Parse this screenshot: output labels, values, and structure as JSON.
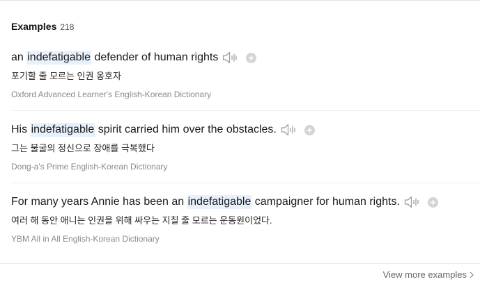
{
  "header": {
    "title": "Examples",
    "count": "218"
  },
  "examples": [
    {
      "before": "an ",
      "keyword": "indefatigable",
      "after": " defender of human rights",
      "translation": "포기할 줄 모르는 인권 옹호자",
      "source": "Oxford Advanced Learner's English-Korean Dictionary"
    },
    {
      "before": "His ",
      "keyword": "indefatigable",
      "after": " spirit carried him over the obstacles.",
      "translation": "그는 불굴의 정신으로 장애를 극복했다",
      "source": "Dong-a's Prime English-Korean Dictionary"
    },
    {
      "before": "For many years Annie has been an ",
      "keyword": "indefatigable",
      "after": " campaigner for human rights.",
      "translation": "여러 해 동안 애니는 인권을 위해 싸우는 지칠 줄 모르는 운동원이었다.",
      "source": "YBM All in All English-Korean Dictionary"
    }
  ],
  "footer": {
    "view_more": "View more examples"
  },
  "icons": {
    "speaker": "speaker-icon",
    "add": "plus-icon",
    "chevron": "chevron-right-icon"
  },
  "colors": {
    "highlight": "#e7f0fb",
    "source_text": "#8a8a8a",
    "icon_gray": "#9a9a9a"
  }
}
